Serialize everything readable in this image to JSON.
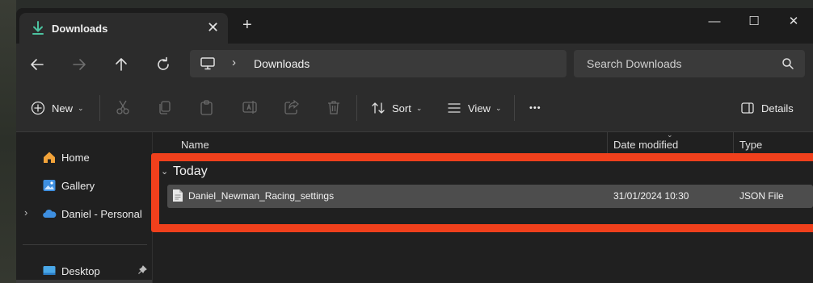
{
  "tab": {
    "title": "Downloads",
    "close_glyph": "✕",
    "add_glyph": "+"
  },
  "window_controls": {
    "minimize": "—",
    "maximize": "☐",
    "close": "✕"
  },
  "nav": {
    "back_icon": "arrow-left-icon",
    "forward_icon": "arrow-right-icon",
    "up_icon": "arrow-up-icon",
    "refresh_icon": "refresh-icon",
    "breadcrumb": [
      "Downloads"
    ],
    "breadcrumb_sep": "›",
    "search_placeholder": "Search Downloads"
  },
  "commands": {
    "new": "New",
    "sort": "Sort",
    "view": "View",
    "more": "•••",
    "details": "Details",
    "chevron": "⌄"
  },
  "sidebar": {
    "items": [
      {
        "label": "Home",
        "icon": "home-icon"
      },
      {
        "label": "Gallery",
        "icon": "gallery-icon"
      },
      {
        "label": "Daniel - Personal",
        "icon": "onedrive-icon",
        "expander": "›"
      },
      {
        "label": "Desktop",
        "icon": "desktop-icon",
        "pinned": true
      }
    ]
  },
  "filelist": {
    "columns": {
      "name": "Name",
      "date_modified": "Date modified",
      "type": "Type"
    },
    "group": {
      "label": "Today",
      "chevron": "⌄"
    },
    "rows": [
      {
        "name": "Daniel_Newman_Racing_settings",
        "date_modified": "31/01/2024 10:30",
        "type": "JSON File"
      }
    ]
  },
  "colors": {
    "accent_download": "#4cc2a0",
    "highlight": "#f0401c",
    "folder_home": "#f2a33a",
    "onedrive": "#3e8fe0"
  }
}
